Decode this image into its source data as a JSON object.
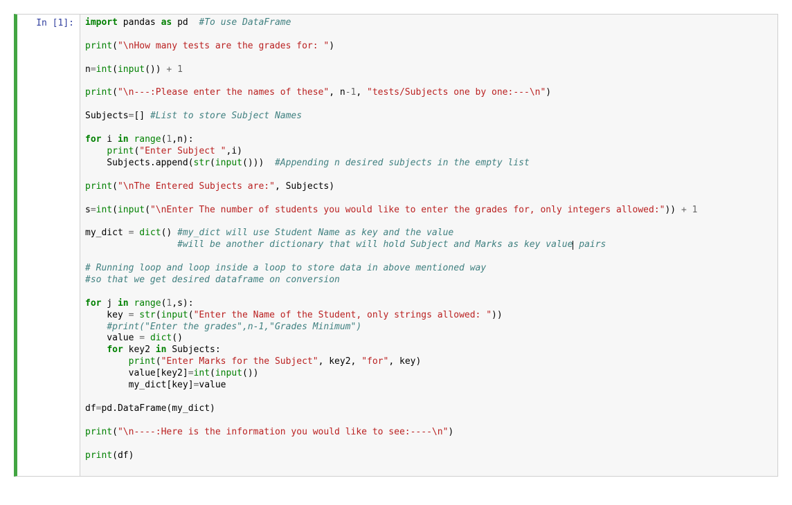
{
  "prompt": {
    "label": "In [1]:"
  },
  "code": {
    "tokens": [
      {
        "t": "import",
        "c": "k"
      },
      {
        "t": " pandas ",
        "c": ""
      },
      {
        "t": "as",
        "c": "k"
      },
      {
        "t": " pd  ",
        "c": ""
      },
      {
        "t": "#To use DataFrame",
        "c": "c"
      },
      {
        "t": "\n\n",
        "c": ""
      },
      {
        "t": "print",
        "c": "nb"
      },
      {
        "t": "(",
        "c": ""
      },
      {
        "t": "\"\\nHow many tests are the grades for: \"",
        "c": "s"
      },
      {
        "t": ")",
        "c": ""
      },
      {
        "t": "\n\n",
        "c": ""
      },
      {
        "t": "n",
        "c": ""
      },
      {
        "t": "=",
        "c": "op"
      },
      {
        "t": "int",
        "c": "nb"
      },
      {
        "t": "(",
        "c": ""
      },
      {
        "t": "input",
        "c": "nb"
      },
      {
        "t": "()) ",
        "c": ""
      },
      {
        "t": "+",
        "c": "op"
      },
      {
        "t": " ",
        "c": ""
      },
      {
        "t": "1",
        "c": "num"
      },
      {
        "t": "\n\n",
        "c": ""
      },
      {
        "t": "print",
        "c": "nb"
      },
      {
        "t": "(",
        "c": ""
      },
      {
        "t": "\"\\n---:Please enter the names of these\"",
        "c": "s"
      },
      {
        "t": ", n",
        "c": ""
      },
      {
        "t": "-",
        "c": "op"
      },
      {
        "t": "1",
        "c": "num"
      },
      {
        "t": ", ",
        "c": ""
      },
      {
        "t": "\"tests/Subjects one by one:---\\n\"",
        "c": "s"
      },
      {
        "t": ")",
        "c": ""
      },
      {
        "t": "\n\n",
        "c": ""
      },
      {
        "t": "Subjects",
        "c": ""
      },
      {
        "t": "=",
        "c": "op"
      },
      {
        "t": "[] ",
        "c": ""
      },
      {
        "t": "#List to store Subject Names",
        "c": "c"
      },
      {
        "t": "\n\n",
        "c": ""
      },
      {
        "t": "for",
        "c": "k"
      },
      {
        "t": " i ",
        "c": ""
      },
      {
        "t": "in",
        "c": "k"
      },
      {
        "t": " ",
        "c": ""
      },
      {
        "t": "range",
        "c": "nb"
      },
      {
        "t": "(",
        "c": ""
      },
      {
        "t": "1",
        "c": "num"
      },
      {
        "t": ",n):",
        "c": ""
      },
      {
        "t": "\n",
        "c": ""
      },
      {
        "t": "    ",
        "c": ""
      },
      {
        "t": "print",
        "c": "nb"
      },
      {
        "t": "(",
        "c": ""
      },
      {
        "t": "\"Enter Subject \"",
        "c": "s"
      },
      {
        "t": ",i)",
        "c": ""
      },
      {
        "t": "\n",
        "c": ""
      },
      {
        "t": "    Subjects.append(",
        "c": ""
      },
      {
        "t": "str",
        "c": "nb"
      },
      {
        "t": "(",
        "c": ""
      },
      {
        "t": "input",
        "c": "nb"
      },
      {
        "t": "()))  ",
        "c": ""
      },
      {
        "t": "#Appending n desired subjects in the empty list",
        "c": "c"
      },
      {
        "t": "\n\n",
        "c": ""
      },
      {
        "t": "print",
        "c": "nb"
      },
      {
        "t": "(",
        "c": ""
      },
      {
        "t": "\"\\nThe Entered Subjects are:\"",
        "c": "s"
      },
      {
        "t": ", Subjects)",
        "c": ""
      },
      {
        "t": "\n\n",
        "c": ""
      },
      {
        "t": "s",
        "c": ""
      },
      {
        "t": "=",
        "c": "op"
      },
      {
        "t": "int",
        "c": "nb"
      },
      {
        "t": "(",
        "c": ""
      },
      {
        "t": "input",
        "c": "nb"
      },
      {
        "t": "(",
        "c": ""
      },
      {
        "t": "\"\\nEnter The number of students you would like to enter the grades for, only integers allowed:\"",
        "c": "s"
      },
      {
        "t": ")) ",
        "c": ""
      },
      {
        "t": "+",
        "c": "op"
      },
      {
        "t": " ",
        "c": ""
      },
      {
        "t": "1",
        "c": "num"
      },
      {
        "t": "\n\n",
        "c": ""
      },
      {
        "t": "my_dict ",
        "c": ""
      },
      {
        "t": "=",
        "c": "op"
      },
      {
        "t": " ",
        "c": ""
      },
      {
        "t": "dict",
        "c": "nb"
      },
      {
        "t": "() ",
        "c": ""
      },
      {
        "t": "#my_dict will use Student Name as key and the value",
        "c": "c"
      },
      {
        "t": "\n",
        "c": ""
      },
      {
        "t": "                 ",
        "c": ""
      },
      {
        "t": "#will be another dictionary that will hold Subject and Marks as key value",
        "c": "c"
      },
      {
        "cursor": true
      },
      {
        "t": " pairs",
        "c": "c"
      },
      {
        "t": "\n\n",
        "c": ""
      },
      {
        "t": "# Running loop and loop inside a loop to store data in above mentioned way",
        "c": "c"
      },
      {
        "t": "\n",
        "c": ""
      },
      {
        "t": "#so that we get desired dataframe on conversion",
        "c": "c"
      },
      {
        "t": "\n\n",
        "c": ""
      },
      {
        "t": "for",
        "c": "k"
      },
      {
        "t": " j ",
        "c": ""
      },
      {
        "t": "in",
        "c": "k"
      },
      {
        "t": " ",
        "c": ""
      },
      {
        "t": "range",
        "c": "nb"
      },
      {
        "t": "(",
        "c": ""
      },
      {
        "t": "1",
        "c": "num"
      },
      {
        "t": ",s):",
        "c": ""
      },
      {
        "t": "\n",
        "c": ""
      },
      {
        "t": "    key ",
        "c": ""
      },
      {
        "t": "=",
        "c": "op"
      },
      {
        "t": " ",
        "c": ""
      },
      {
        "t": "str",
        "c": "nb"
      },
      {
        "t": "(",
        "c": ""
      },
      {
        "t": "input",
        "c": "nb"
      },
      {
        "t": "(",
        "c": ""
      },
      {
        "t": "\"Enter the Name of the Student, only strings allowed: \"",
        "c": "s"
      },
      {
        "t": "))",
        "c": ""
      },
      {
        "t": "\n",
        "c": ""
      },
      {
        "t": "    ",
        "c": ""
      },
      {
        "t": "#print(\"Enter the grades\",n-1,\"Grades Minimum\")",
        "c": "c"
      },
      {
        "t": "\n",
        "c": ""
      },
      {
        "t": "    value ",
        "c": ""
      },
      {
        "t": "=",
        "c": "op"
      },
      {
        "t": " ",
        "c": ""
      },
      {
        "t": "dict",
        "c": "nb"
      },
      {
        "t": "()",
        "c": ""
      },
      {
        "t": "\n",
        "c": ""
      },
      {
        "t": "    ",
        "c": ""
      },
      {
        "t": "for",
        "c": "k"
      },
      {
        "t": " key2 ",
        "c": ""
      },
      {
        "t": "in",
        "c": "k"
      },
      {
        "t": " Subjects:",
        "c": ""
      },
      {
        "t": "\n",
        "c": ""
      },
      {
        "t": "        ",
        "c": ""
      },
      {
        "t": "print",
        "c": "nb"
      },
      {
        "t": "(",
        "c": ""
      },
      {
        "t": "\"Enter Marks for the Subject\"",
        "c": "s"
      },
      {
        "t": ", key2, ",
        "c": ""
      },
      {
        "t": "\"for\"",
        "c": "s"
      },
      {
        "t": ", key)",
        "c": ""
      },
      {
        "t": "\n",
        "c": ""
      },
      {
        "t": "        value[key2]",
        "c": ""
      },
      {
        "t": "=",
        "c": "op"
      },
      {
        "t": "int",
        "c": "nb"
      },
      {
        "t": "(",
        "c": ""
      },
      {
        "t": "input",
        "c": "nb"
      },
      {
        "t": "())",
        "c": ""
      },
      {
        "t": "\n",
        "c": ""
      },
      {
        "t": "        my_dict[key]",
        "c": ""
      },
      {
        "t": "=",
        "c": "op"
      },
      {
        "t": "value",
        "c": ""
      },
      {
        "t": "\n\n",
        "c": ""
      },
      {
        "t": "df",
        "c": ""
      },
      {
        "t": "=",
        "c": "op"
      },
      {
        "t": "pd.DataFrame(my_dict)",
        "c": ""
      },
      {
        "t": "\n\n",
        "c": ""
      },
      {
        "t": "print",
        "c": "nb"
      },
      {
        "t": "(",
        "c": ""
      },
      {
        "t": "\"\\n----:Here is the information you would like to see:----\\n\"",
        "c": "s"
      },
      {
        "t": ")",
        "c": ""
      },
      {
        "t": "\n\n",
        "c": ""
      },
      {
        "t": "print",
        "c": "nb"
      },
      {
        "t": "(df)",
        "c": ""
      },
      {
        "t": "\n\n",
        "c": ""
      }
    ]
  }
}
